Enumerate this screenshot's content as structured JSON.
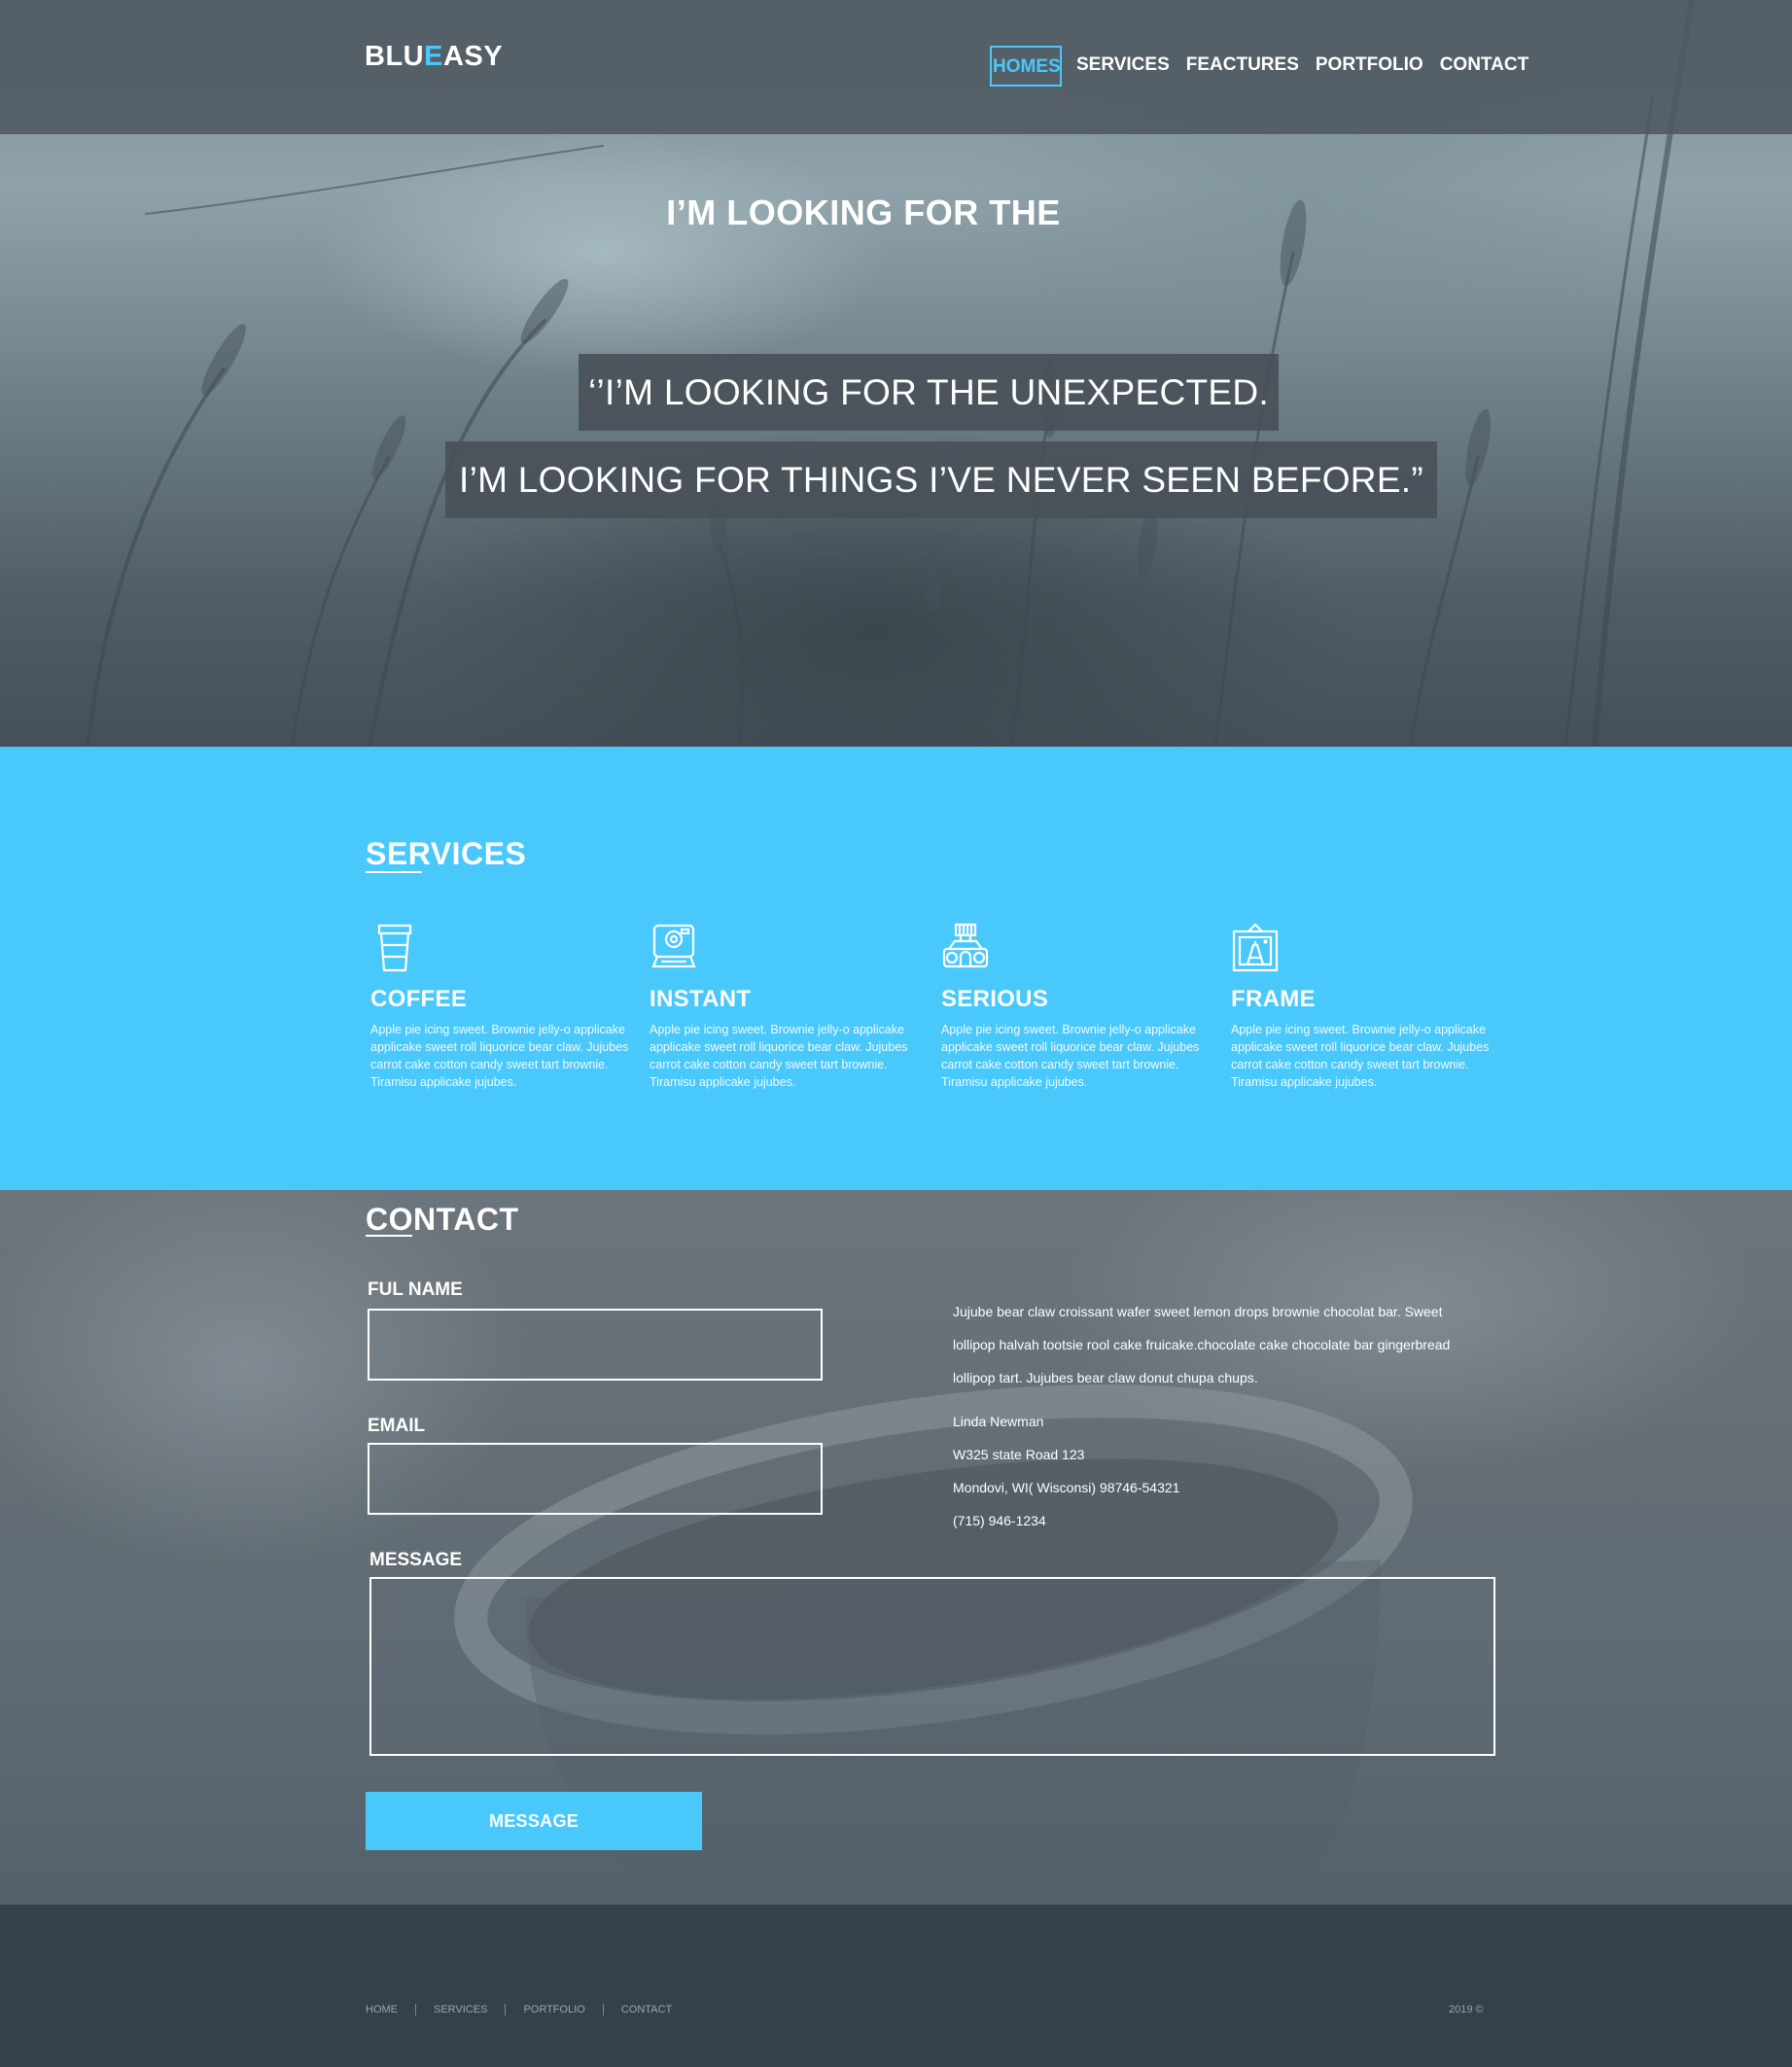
{
  "brand": {
    "logo_part1": "BLU",
    "logo_accent": "E",
    "logo_part2": "ASY",
    "accent_color": "#49c8fc"
  },
  "nav": {
    "items": [
      {
        "label": "HOMES",
        "active": true
      },
      {
        "label": "SERVICES",
        "active": false
      },
      {
        "label": "FEACTURES",
        "active": false
      },
      {
        "label": "PORTFOLIO",
        "active": false
      },
      {
        "label": "CONTACT",
        "active": false
      }
    ]
  },
  "hero": {
    "headline": "I’M LOOKING FOR THE",
    "quote_line1": "‘’I’M LOOKING FOR THE UNEXPECTED.",
    "quote_line2": "I’M LOOKING FOR THINGS I’VE NEVER SEEN BEFORE.”"
  },
  "services": {
    "title": "SERVICES",
    "background_color": "#49c8fc",
    "items": [
      {
        "icon": "coffee-cup-icon",
        "name": "COFFEE",
        "text": "Apple pie icing sweet. Brownie jelly-o applicake applicake sweet roll liquorice bear claw. Jujubes carrot cake cotton candy sweet tart brownie. Tiramisu applicake jujubes."
      },
      {
        "icon": "instant-camera-icon",
        "name": "INSTANT",
        "text": "Apple pie icing sweet. Brownie jelly-o applicake applicake sweet roll liquorice bear claw. Jujubes carrot cake cotton candy sweet tart brownie. Tiramisu applicake jujubes."
      },
      {
        "icon": "film-camera-icon",
        "name": "SERIOUS",
        "text": "Apple pie icing sweet. Brownie jelly-o applicake applicake sweet roll liquorice bear claw. Jujubes carrot cake cotton candy sweet tart brownie. Tiramisu applicake jujubes."
      },
      {
        "icon": "picture-frame-icon",
        "name": "FRAME",
        "text": "Apple pie icing sweet. Brownie jelly-o applicake applicake sweet roll liquorice bear claw. Jujubes carrot cake cotton candy sweet tart brownie. Tiramisu applicake jujubes."
      }
    ]
  },
  "contact": {
    "title": "CONTACT",
    "fields": {
      "name_label": "FUL NAME",
      "email_label": "EMAIL",
      "message_label": "MESSAGE"
    },
    "submit_label": "MESSAGE",
    "description": "Jujube bear claw croissant wafer sweet lemon drops brownie chocolat bar. Sweet lollipop halvah tootsie rool cake fruicake.chocolate cake chocolate bar gingerbread lollipop tart. Jujubes bear claw donut chupa chups.",
    "address": {
      "name": "Linda Newman",
      "street": "W325 state Road 123",
      "city": "Mondovi, WI( Wisconsi) 98746-54321",
      "phone": "(715) 946-1234"
    }
  },
  "footer": {
    "links": [
      "HOME",
      "SERVICES",
      "PORTFOLIO",
      "CONTACT"
    ],
    "copyright": "2019 ©"
  }
}
